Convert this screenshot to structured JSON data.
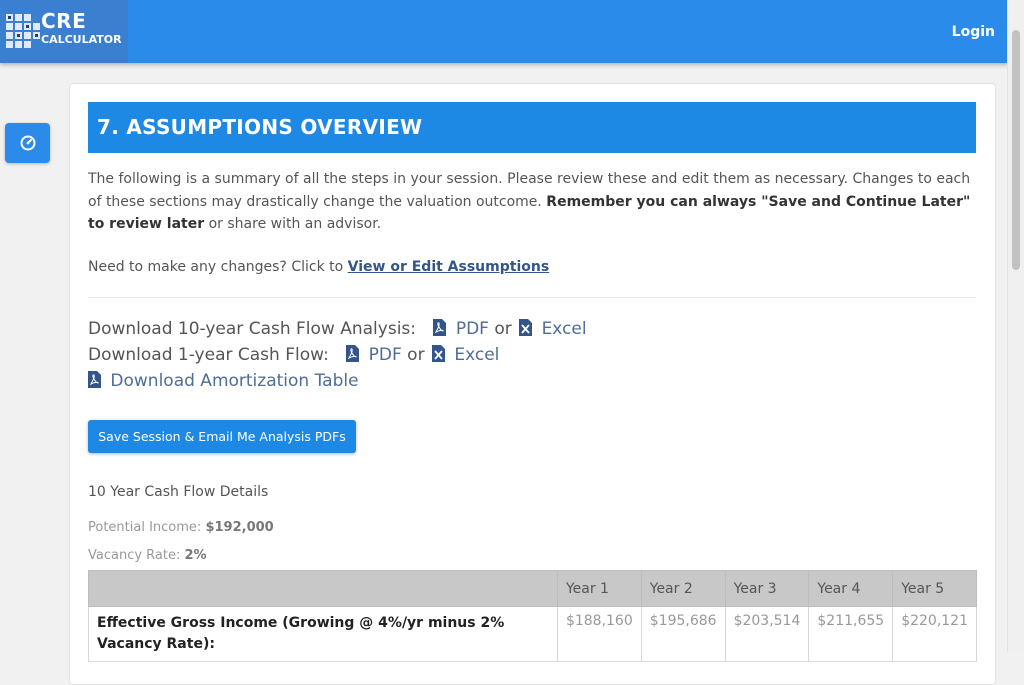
{
  "header": {
    "logo_line1": "CRE",
    "logo_line2": "CALCULATOR",
    "login_label": "Login"
  },
  "sidebar": {
    "button_icon": "dashboard-gauge-icon"
  },
  "section": {
    "title": "7. ASSUMPTIONS OVERVIEW",
    "intro_text": "The following is a summary of all the steps in your session. Please review these and edit them as necessary. Changes to each of these sections may drastically change the valuation outcome. ",
    "intro_bold": "Remember you can always \"Save and Continue Later\" to review later",
    "intro_tail": " or share with an advisor.",
    "changes_prompt": "Need to make any changes? Click to ",
    "changes_link": "View or Edit Assumptions"
  },
  "downloads": {
    "ten_year_label": "Download 10-year Cash Flow Analysis:",
    "one_year_label": "Download 1-year Cash Flow:",
    "pdf_label": "PDF",
    "or_label": "or",
    "excel_label": "Excel",
    "amortization_label": "Download Amortization Table"
  },
  "save_button_label": "Save Session & Email Me Analysis PDFs",
  "details": {
    "title": "10 Year Cash Flow Details",
    "potential_income_label": "Potential Income:",
    "potential_income_value": "$192,000",
    "vacancy_rate_label": "Vacancy Rate:",
    "vacancy_rate_value": "2%"
  },
  "table": {
    "headers": [
      "",
      "Year 1",
      "Year 2",
      "Year 3",
      "Year 4",
      "Year 5"
    ],
    "rows": [
      {
        "label": "Effective Gross Income (Growing @ 4%/yr minus 2% Vacancy Rate):",
        "values": [
          "$188,160",
          "$195,686",
          "$203,514",
          "$211,655",
          "$220,121"
        ]
      }
    ]
  },
  "colors": {
    "topbar": "#2a8bea",
    "section_header": "#1e88e5",
    "link": "#33558a"
  }
}
